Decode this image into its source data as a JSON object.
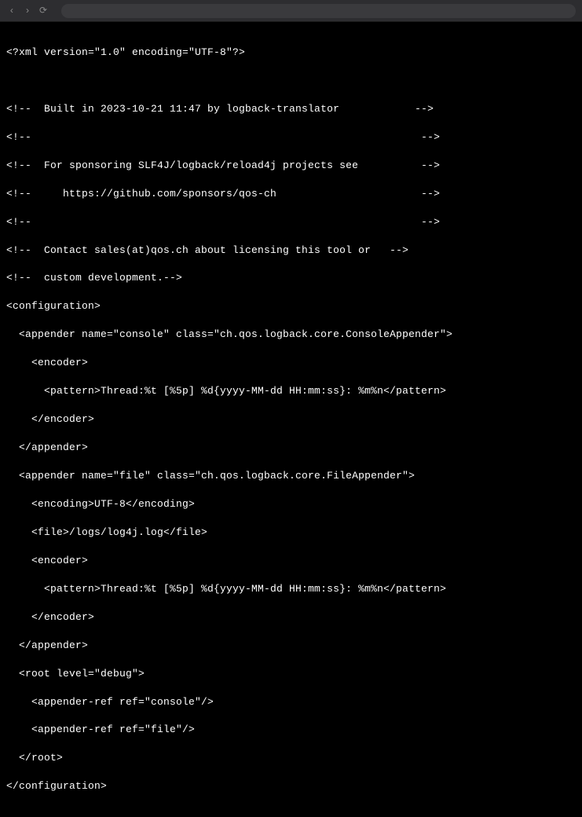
{
  "chrome": {
    "back": "‹",
    "forward": "›",
    "reload": "⟳"
  },
  "code": {
    "line0": "<?xml version=\"1.0\" encoding=\"UTF-8\"?>",
    "line1": "",
    "line2": "<!--  Built in 2023-10-21 11:47 by logback-translator            -->",
    "line3": "<!--                                                              -->",
    "line4": "<!--  For sponsoring SLF4J/logback/reload4j projects see          -->",
    "line5": "<!--     https://github.com/sponsors/qos-ch                       -->",
    "line6": "<!--                                                              -->",
    "line7": "<!--  Contact sales(at)qos.ch about licensing this tool or   -->",
    "line8": "<!--  custom development.-->",
    "line9": "<configuration>",
    "line10": "  <appender name=\"console\" class=\"ch.qos.logback.core.ConsoleAppender\">",
    "line11": "    <encoder>",
    "line12": "      <pattern>Thread:%t [%5p] %d{yyyy-MM-dd HH:mm:ss}: %m%n</pattern>",
    "line13": "    </encoder>",
    "line14": "  </appender>",
    "line15": "  <appender name=\"file\" class=\"ch.qos.logback.core.FileAppender\">",
    "line16": "    <encoding>UTF-8</encoding>",
    "line17": "    <file>/logs/log4j.log</file>",
    "line18": "    <encoder>",
    "line19": "      <pattern>Thread:%t [%5p] %d{yyyy-MM-dd HH:mm:ss}: %m%n</pattern>",
    "line20": "    </encoder>",
    "line21": "  </appender>",
    "line22": "  <root level=\"debug\">",
    "line23": "    <appender-ref ref=\"console\"/>",
    "line24": "    <appender-ref ref=\"file\"/>",
    "line25": "  </root>",
    "line26": "</configuration>"
  }
}
